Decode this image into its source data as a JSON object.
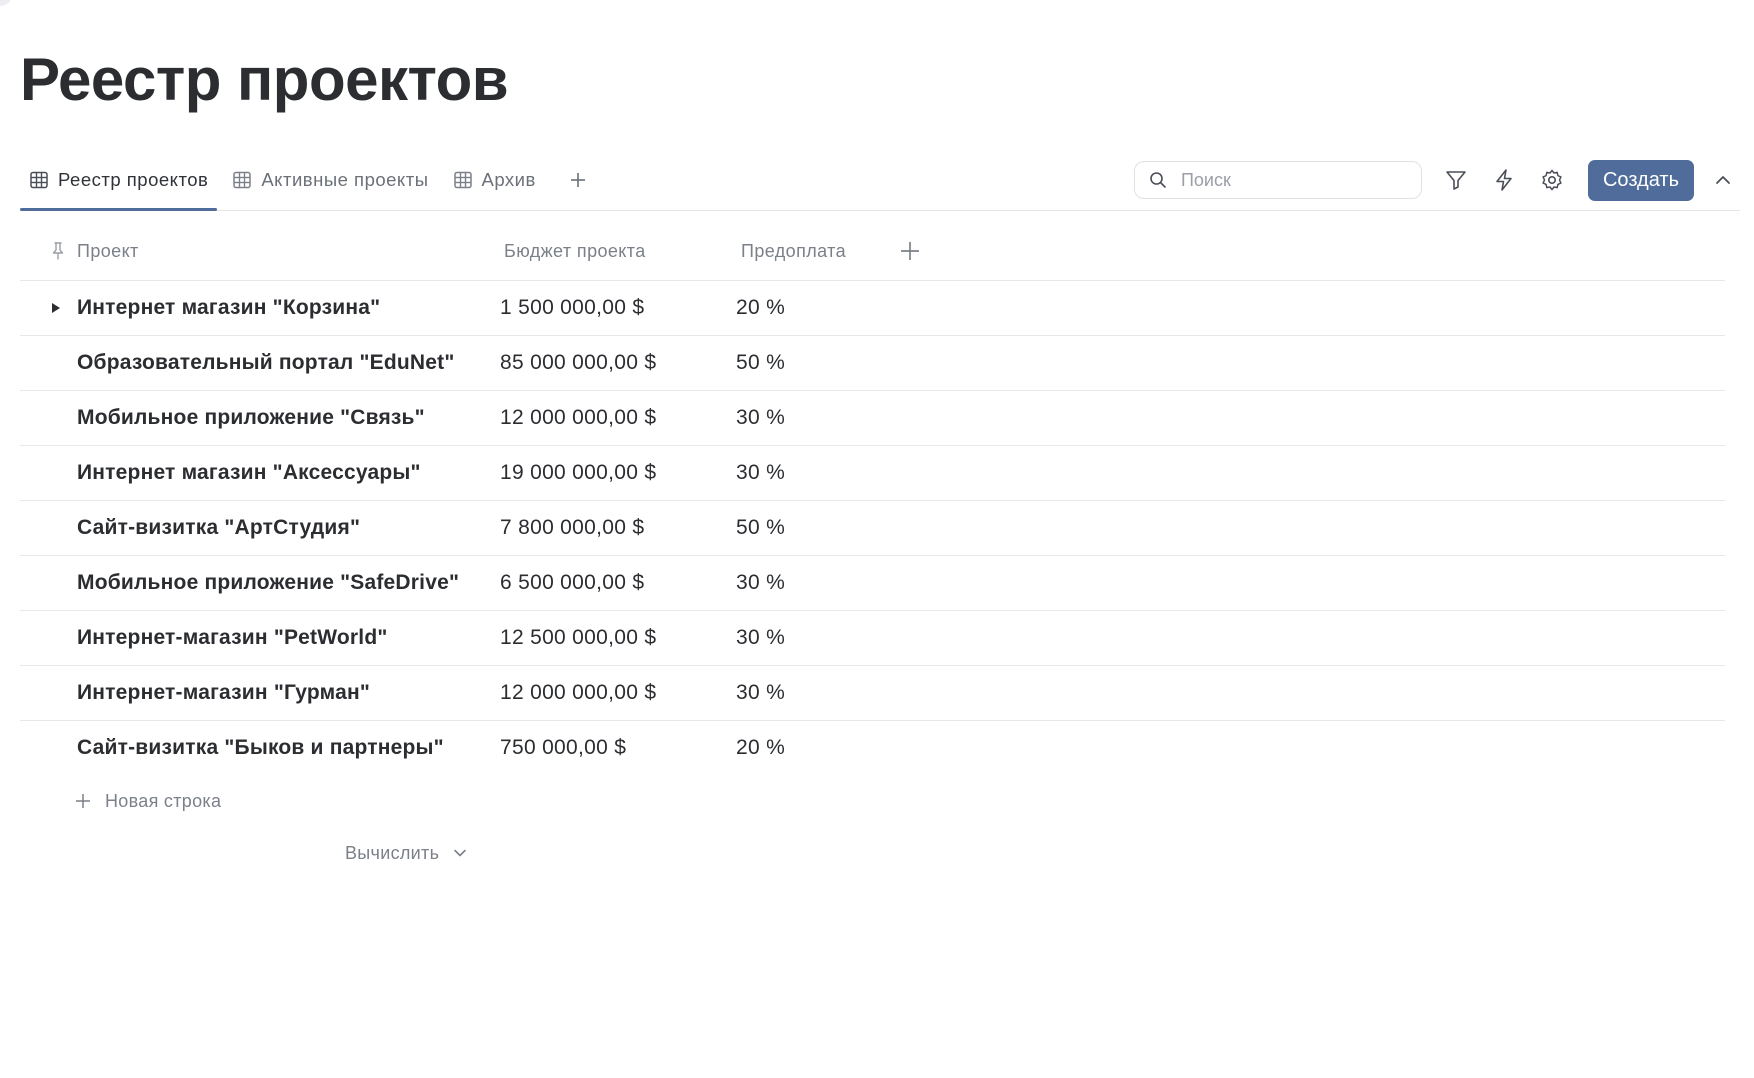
{
  "page": {
    "title": "Реестр проектов"
  },
  "tabs": [
    {
      "label": "Реестр проектов",
      "icon": "table-icon",
      "active": true
    },
    {
      "label": "Активные проекты",
      "icon": "table-icon",
      "active": false
    },
    {
      "label": "Архив",
      "icon": "table-icon",
      "active": false
    }
  ],
  "toolbar": {
    "search_placeholder": "Поиск",
    "search_value": "",
    "create_label": "Создать",
    "icons": [
      "filter-icon",
      "lightning-icon",
      "gear-icon",
      "chevron-up-icon"
    ]
  },
  "table": {
    "columns": [
      "Проект",
      "Бюджет проекта",
      "Предоплата"
    ],
    "rows": [
      {
        "name": "Интернет магазин \"Корзина\"",
        "budget": "1 500 000,00 $",
        "prepay": "20 %",
        "expandable": true
      },
      {
        "name": "Образовательный портал \"EduNet\"",
        "budget": "85 000 000,00 $",
        "prepay": "50 %"
      },
      {
        "name": "Мобильное приложение \"Связь\"",
        "budget": "12 000 000,00 $",
        "prepay": "30 %"
      },
      {
        "name": "Интернет магазин \"Аксессуары\"",
        "budget": "19 000 000,00 $",
        "prepay": "30 %"
      },
      {
        "name": "Сайт-визитка \"АртСтудия\"",
        "budget": "7 800 000,00 $",
        "prepay": "50 %"
      },
      {
        "name": "Мобильное приложение \"SafeDrive\"",
        "budget": "6 500 000,00 $",
        "prepay": "30 %"
      },
      {
        "name": "Интернет-магазин \"PetWorld\"",
        "budget": "12 500 000,00 $",
        "prepay": "30 %"
      },
      {
        "name": "Интернет-магазин \"Гурман\"",
        "budget": "12 000 000,00 $",
        "prepay": "30 %"
      },
      {
        "name": "Сайт-визитка \"Быков и партнеры\"",
        "budget": "750 000,00 $",
        "prepay": "20 %"
      }
    ],
    "new_row_label": "Новая строка",
    "calculate_label": "Вычислить"
  },
  "colors": {
    "accent": "#4f6c9b",
    "text": "#2b2d31",
    "muted": "#7b8089",
    "border": "#e6e8eb"
  }
}
